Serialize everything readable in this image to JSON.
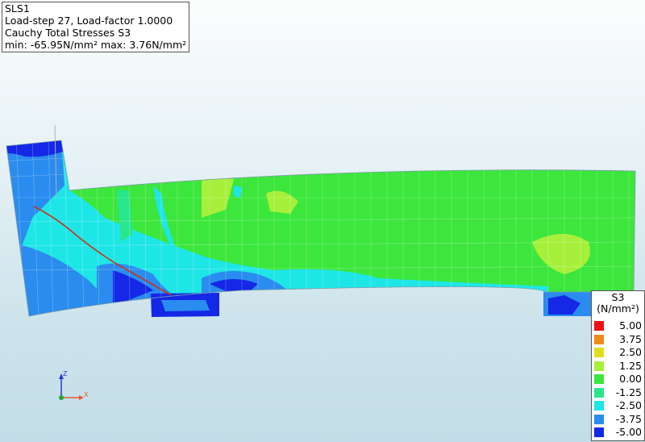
{
  "info": {
    "line1": "SLS1",
    "line2": "Load-step 27, Load-factor 1.0000",
    "line3": "Cauchy Total Stresses S3",
    "line4": "min: -65.95N/mm² max:  3.76N/mm²"
  },
  "legend": {
    "title1": "S3",
    "title2": "(N/mm²)",
    "entries": [
      {
        "label": "5.00",
        "color": "#ee1111"
      },
      {
        "label": "3.75",
        "color": "#f08a1a"
      },
      {
        "label": "2.50",
        "color": "#dede1e"
      },
      {
        "label": "1.25",
        "color": "#a6f03c"
      },
      {
        "label": "0.00",
        "color": "#3ce63c"
      },
      {
        "label": "-1.25",
        "color": "#28e68c"
      },
      {
        "label": "-2.50",
        "color": "#1ee6e6"
      },
      {
        "label": "-3.75",
        "color": "#2a8cee"
      },
      {
        "label": "-5.00",
        "color": "#1428e6"
      }
    ]
  },
  "axes": {
    "x_label": "X",
    "z_label": "Z"
  }
}
